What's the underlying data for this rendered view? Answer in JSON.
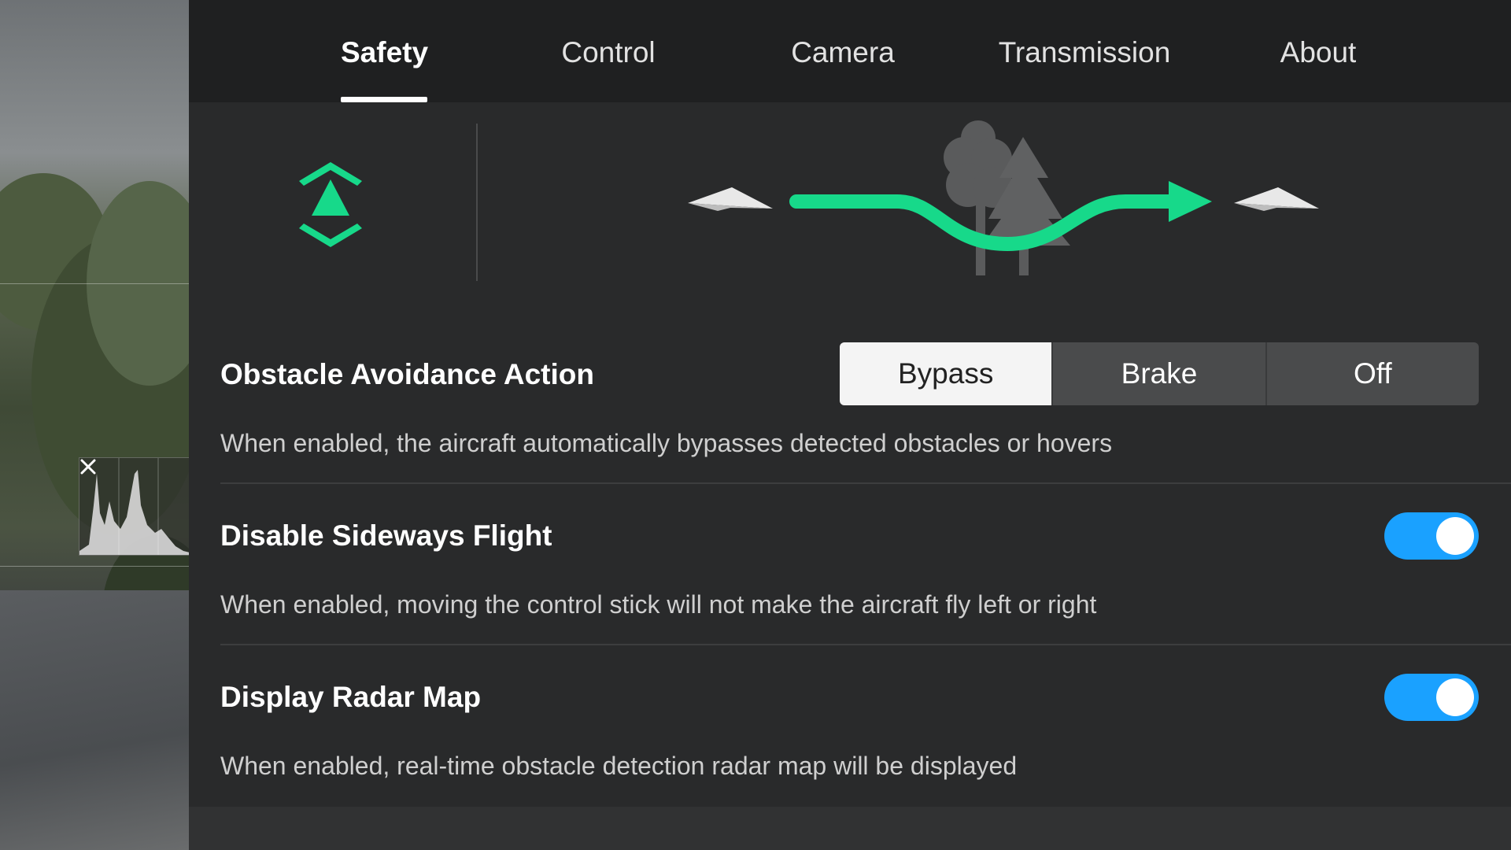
{
  "tabs": [
    {
      "label": "Safety",
      "active": true
    },
    {
      "label": "Control",
      "active": false
    },
    {
      "label": "Camera",
      "active": false
    },
    {
      "label": "Transmission",
      "active": false
    },
    {
      "label": "About",
      "active": false
    }
  ],
  "colors": {
    "accent_green": "#17d98a",
    "toggle_blue": "#1aa1ff",
    "panel_bg": "#292a2b",
    "tabbar_bg": "#1f2021"
  },
  "illustration": {
    "icons": [
      "obstacle-avoidance-icon",
      "aircraft-icon",
      "trees-icon",
      "bypass-path-arrow-icon",
      "aircraft-icon"
    ]
  },
  "settings": {
    "obstacle_avoidance": {
      "title": "Obstacle Avoidance Action",
      "description": "When enabled, the aircraft automatically bypasses detected obstacles or hovers",
      "options": [
        "Bypass",
        "Brake",
        "Off"
      ],
      "selected": "Bypass"
    },
    "sideways_flight": {
      "title": "Disable Sideways Flight",
      "description": "When enabled, moving the control stick will not make the aircraft fly left or right",
      "enabled": true
    },
    "radar_map": {
      "title": "Display Radar Map",
      "description": "When enabled, real-time obstacle detection radar map will be displayed",
      "enabled": true
    }
  },
  "camera_feed": {
    "histogram_icons": [
      "close-icon"
    ]
  }
}
